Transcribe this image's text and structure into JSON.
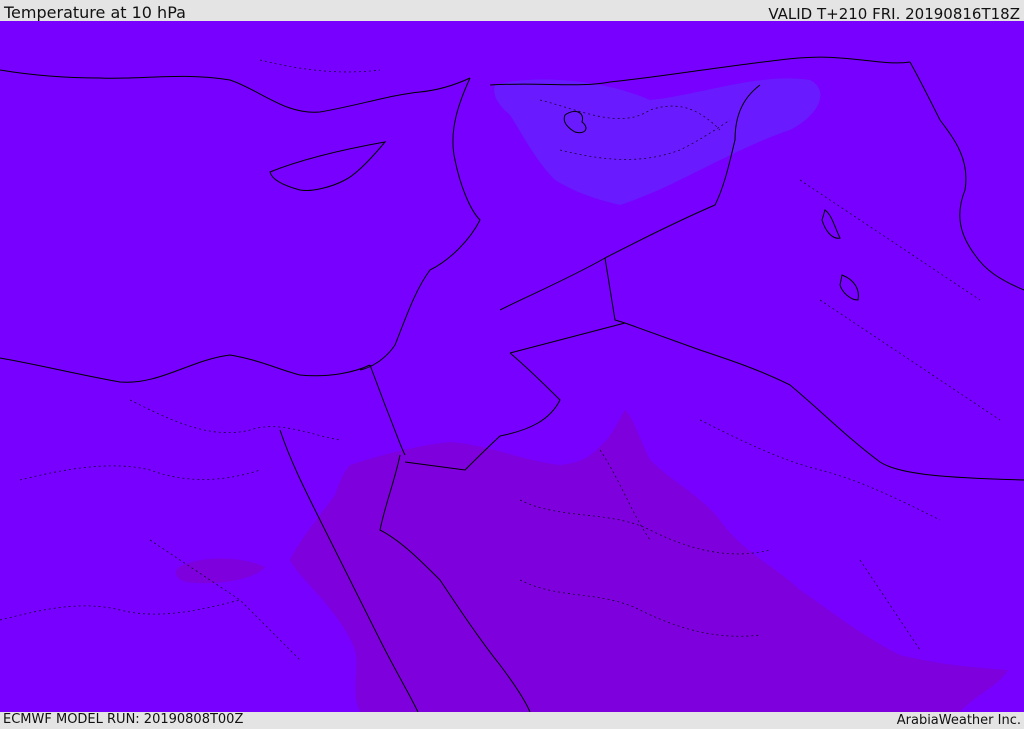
{
  "header": {
    "title": "Temperature at 10 hPa",
    "valid": "VALID T+210 FRI. 20190816T18Z"
  },
  "footer": {
    "model_run": "ECMWF MODEL RUN: 20190808T00Z",
    "credit": "ArabiaWeather Inc."
  },
  "colors": {
    "background": "#7700ff",
    "cool_region": "#6a1aff",
    "warm_region": "#7e00dd",
    "border": "#000000"
  }
}
